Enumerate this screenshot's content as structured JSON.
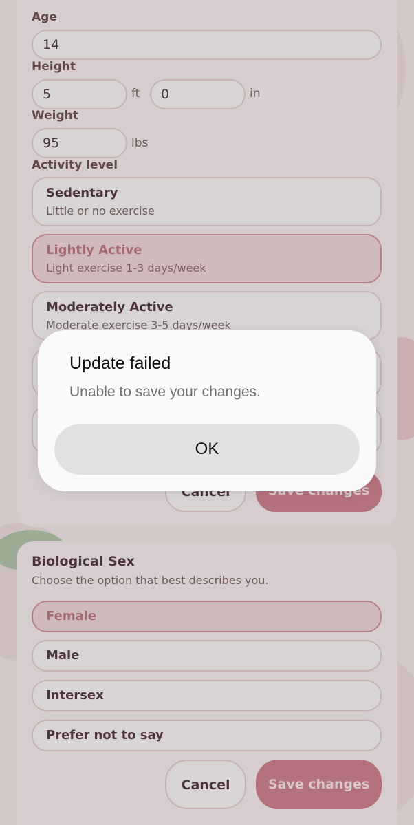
{
  "profile_form": {
    "age": {
      "label": "Age",
      "value": "14"
    },
    "height": {
      "label": "Height",
      "feet": "5",
      "feet_unit": "ft",
      "inches": "0",
      "inches_unit": "in"
    },
    "weight": {
      "label": "Weight",
      "value": "95",
      "unit": "lbs"
    },
    "activity": {
      "label": "Activity level",
      "options": [
        {
          "title": "Sedentary",
          "subtitle": "Little or no exercise",
          "selected": false
        },
        {
          "title": "Lightly Active",
          "subtitle": "Light exercise 1-3 days/week",
          "selected": true
        },
        {
          "title": "Moderately Active",
          "subtitle": "Moderate exercise 3-5 days/week",
          "selected": false
        }
      ]
    },
    "cancel_label": "Cancel",
    "save_label": "Save changes"
  },
  "biological_sex": {
    "title": "Biological Sex",
    "subtitle": "Choose the option that best describes you.",
    "options": [
      {
        "label": "Female",
        "selected": true
      },
      {
        "label": "Male",
        "selected": false
      },
      {
        "label": "Intersex",
        "selected": false
      },
      {
        "label": "Prefer not to say",
        "selected": false
      }
    ],
    "cancel_label": "Cancel",
    "save_label": "Save changes"
  },
  "alert": {
    "title": "Update failed",
    "message": "Unable to save your changes.",
    "ok_label": "OK"
  },
  "colors": {
    "accent": "#c8707e",
    "selected_bg": "#f0d3d6",
    "selected_text": "#b56672",
    "text_dark": "#3d1f27"
  }
}
